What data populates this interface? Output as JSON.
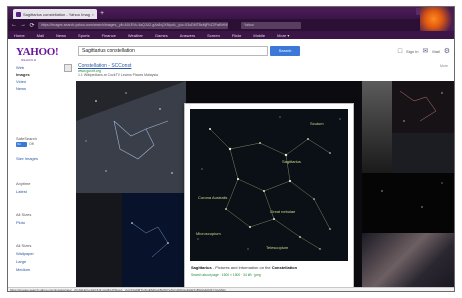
{
  "browser": {
    "tab_title": "Sagittarius constellation - Yahoo Image Search Results",
    "tab_close": "×",
    "new_tab": "+",
    "url": "https://images.search.yahoo.com/search/images;_ylt=A0LEVu.4aQJUZ.gAx8xjJXNyoA;_ylu=X3oDMTBsMjFhZ2FwBHNlYwNzYwRjb2xvA2",
    "search_engine_box": "Yahoo",
    "window_controls": [
      "–",
      "□",
      "×"
    ],
    "nav_buttons": [
      "←",
      "→",
      "⟳"
    ],
    "toolbar_icons": [
      "☆",
      "⌂",
      "⬇",
      "≡"
    ]
  },
  "menubar": {
    "items": [
      "Home",
      "Mail",
      "News",
      "Sports",
      "Finance",
      "Weather",
      "Games",
      "Answers",
      "Screen",
      "Flickr",
      "Mobile",
      "More ▾"
    ]
  },
  "header": {
    "logo": "YAHOO!",
    "logo_sub": "SEARCH",
    "query": "Sagittarius constellation",
    "search_button": "Search",
    "sign_in": "Sign In",
    "mail": "Mail"
  },
  "left_nav": {
    "items": [
      "Web",
      "Images",
      "Video",
      "News"
    ],
    "safesearch_label": "SafeSearch",
    "toggle_on": "On",
    "toggle_label": "Off",
    "similar": "Size Images",
    "filters": [
      "Anytime",
      "Latest"
    ],
    "sizes_title": "All Sizes",
    "sizes": [
      "Pluto"
    ],
    "colors_title": "All Sizes",
    "colors": [
      "Wallpaper",
      "Large",
      "Medium"
    ]
  },
  "result": {
    "title": "Constellation - SCConst",
    "url": "www.gocrit.org",
    "desc": "1.1 Wikipedians at CockTV Learns Places Malaysia",
    "filter": "More"
  },
  "preview": {
    "caption_bold": "Sagittarius",
    "caption_rest": " - Pictures and information on the ",
    "caption_bold2": "Constellation",
    "source": "Search about page · 1500 × 1500 · 34 kB · jpeg",
    "labels": [
      "Sagittarius",
      "Corona Australis",
      "Scutum",
      "Microscopium",
      "Great nebulae",
      "Telescopium"
    ]
  },
  "status_text": "https://images.search.yahoo.com/images/view;_ylt=A0LEVu.4aQJUZ.gAx8xjJXNyoA;_ylu=X3oDMTIyZmE5dGx1BHNlYwNzcgRzbGsDaW1nBG9pZAM4YzAyMjk1",
  "colors": {
    "yahoo_purple": "#6b16a0",
    "link_blue": "#2957a4",
    "button_blue": "#3b78d8",
    "url_green": "#1f8a3a",
    "chrome_dark": "#2b0f35"
  },
  "icons": [
    "back-arrow-icon",
    "forward-arrow-icon",
    "reload-icon",
    "star-icon",
    "home-icon",
    "download-icon",
    "menu-icon",
    "user-icon",
    "mail-icon",
    "settings-icon"
  ]
}
